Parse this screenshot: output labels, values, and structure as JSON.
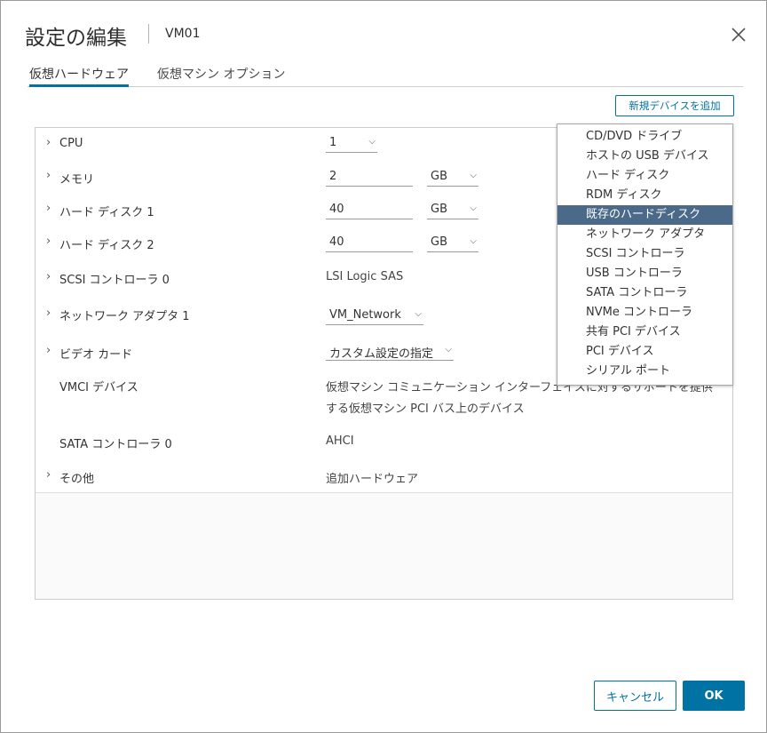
{
  "dialog": {
    "title": "設定の編集",
    "vm_name": "VM01"
  },
  "tabs": [
    {
      "label": "仮想ハードウェア"
    },
    {
      "label": "仮想マシン オプション"
    }
  ],
  "add_device_label": "新規デバイスを追加",
  "hardware": {
    "cpu": {
      "label": "CPU",
      "value": "1"
    },
    "memory": {
      "label": "メモリ",
      "value": "2",
      "unit": "GB"
    },
    "disk1": {
      "label": "ハード ディスク 1",
      "value": "40",
      "unit": "GB"
    },
    "disk2": {
      "label": "ハード ディスク 2",
      "value": "40",
      "unit": "GB"
    },
    "scsi": {
      "label": "SCSI コントローラ 0",
      "value": "LSI Logic SAS"
    },
    "network": {
      "label": "ネットワーク アダプタ 1",
      "value": "VM_Network"
    },
    "video": {
      "label": "ビデオ カード",
      "value": "カスタム設定の指定"
    },
    "vmci": {
      "label": "VMCI デバイス",
      "value_line1": "仮想マシン コミュニケーション インターフェイスに対するサポートを提供",
      "value_line2": "する仮想マシン PCI バス上のデバイス"
    },
    "sata": {
      "label": "SATA コントローラ 0",
      "value": "AHCI"
    },
    "other": {
      "label": "その他",
      "value": "追加ハードウェア"
    }
  },
  "device_menu": {
    "items": [
      "CD/DVD ドライブ",
      "ホストの USB デバイス",
      "ハード ディスク",
      "RDM ディスク",
      "既存のハードディスク",
      "ネットワーク アダプタ",
      "SCSI コントローラ",
      "USB コントローラ",
      "SATA コントローラ",
      "NVMe コントローラ",
      "共有 PCI デバイス",
      "PCI デバイス",
      "シリアル ポート"
    ],
    "selected": "既存のハードディスク"
  },
  "buttons": {
    "cancel": "キャンセル",
    "ok": "OK"
  },
  "colors": {
    "accent": "#0072a3",
    "menu_selected": "#4b6a8a"
  }
}
